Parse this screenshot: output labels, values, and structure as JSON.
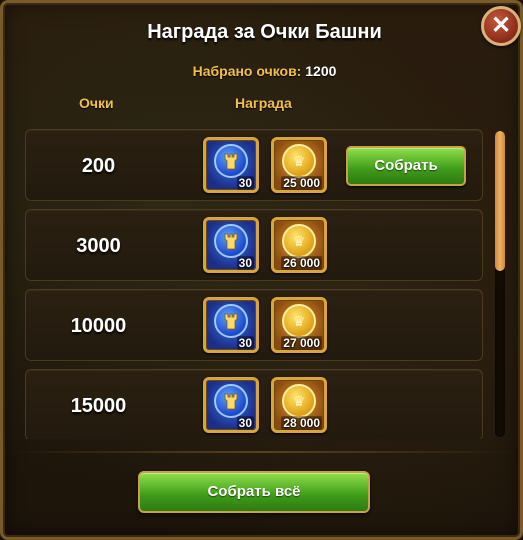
{
  "dialog": {
    "title": "Награда за Очки Башни",
    "score_label": "Набрано очков:",
    "score_value": "1200",
    "close_icon": "close-icon"
  },
  "columns": {
    "points": "Очки",
    "reward": "Награда"
  },
  "rows": [
    {
      "points": "200",
      "item1_qty": "30",
      "item2_qty": "25 000",
      "collect_label": "Собрать"
    },
    {
      "points": "3000",
      "item1_qty": "30",
      "item2_qty": "26 000"
    },
    {
      "points": "10000",
      "item1_qty": "30",
      "item2_qty": "27 000"
    },
    {
      "points": "15000",
      "item1_qty": "30",
      "item2_qty": "28 000"
    }
  ],
  "icons": {
    "item1": "tower-token-icon",
    "item2": "gold-coin-icon"
  },
  "footer": {
    "collect_all_label": "Собрать всё"
  },
  "colors": {
    "accent_gold": "#f2c04a",
    "button_green": "#3e9a1a",
    "frame_gold": "#d9a53a"
  }
}
